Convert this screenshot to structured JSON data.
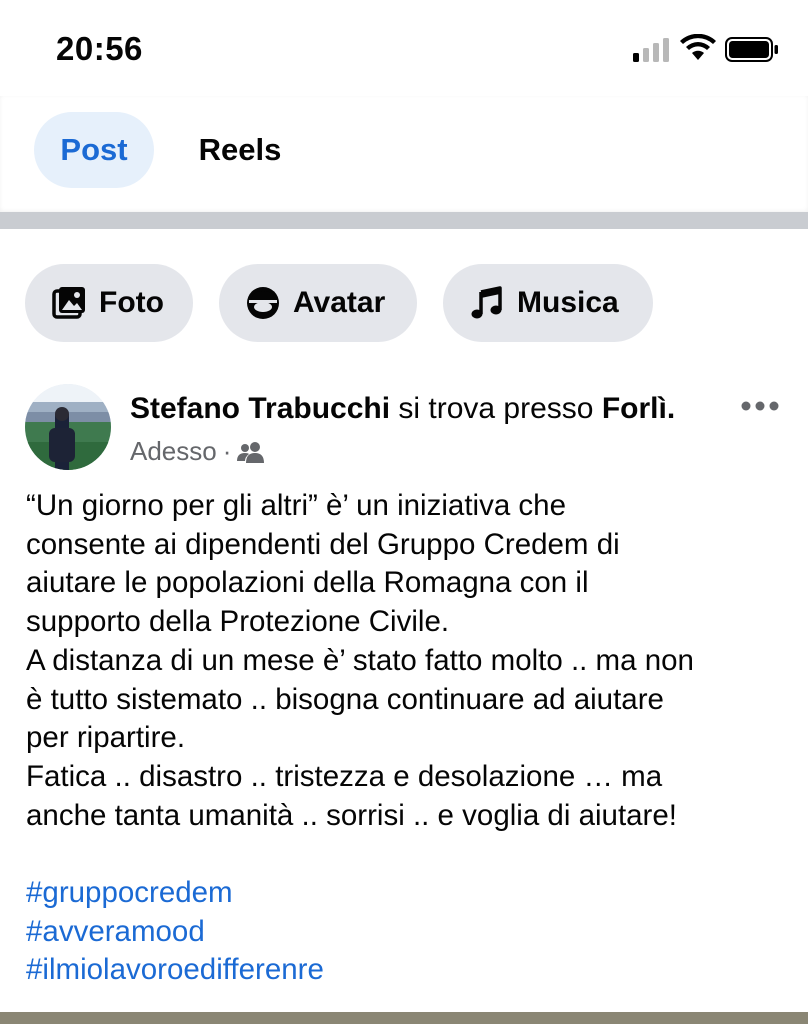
{
  "status_bar": {
    "time": "20:56",
    "icons": [
      "cellular-signal-icon",
      "wifi-icon",
      "battery-icon"
    ]
  },
  "tabs": [
    {
      "label": "Post",
      "selected": true
    },
    {
      "label": "Reels",
      "selected": false
    }
  ],
  "chips": [
    {
      "label": "Foto",
      "icon": "photo-icon"
    },
    {
      "label": "Avatar",
      "icon": "avatar-icon"
    },
    {
      "label": "Musica",
      "icon": "music-note-icon"
    }
  ],
  "post": {
    "author": "Stefano Trabucchi",
    "location_text": "si trova presso",
    "location": "Forlì.",
    "timestamp": "Adesso",
    "separator": "·",
    "audience_icon": "friends-icon",
    "body_lines": [
      "“Un giorno per gli altri” è’ un iniziativa che",
      "consente ai dipendenti del Gruppo Credem di",
      "aiutare le popolazioni della Romagna con il",
      "supporto della Protezione Civile.",
      "A distanza di un mese è’ stato fatto molto .. ma non",
      "è tutto sistemato .. bisogna continuare ad aiutare",
      "per ripartire.",
      "Fatica .. disastro .. tristezza e desolazione … ma",
      "anche tanta umanità .. sorrisi .. e voglia di aiutare!"
    ],
    "hashtags": [
      "#gruppocredem",
      "#avveramood",
      "#ilmiolavoroedifferenre"
    ]
  },
  "colors": {
    "accent": "#1b6ad4",
    "tab_selected_bg": "#e6f0fb",
    "chip_bg": "#e4e6eb",
    "divider": "#c9ccd1",
    "meta_text": "#65676b"
  }
}
